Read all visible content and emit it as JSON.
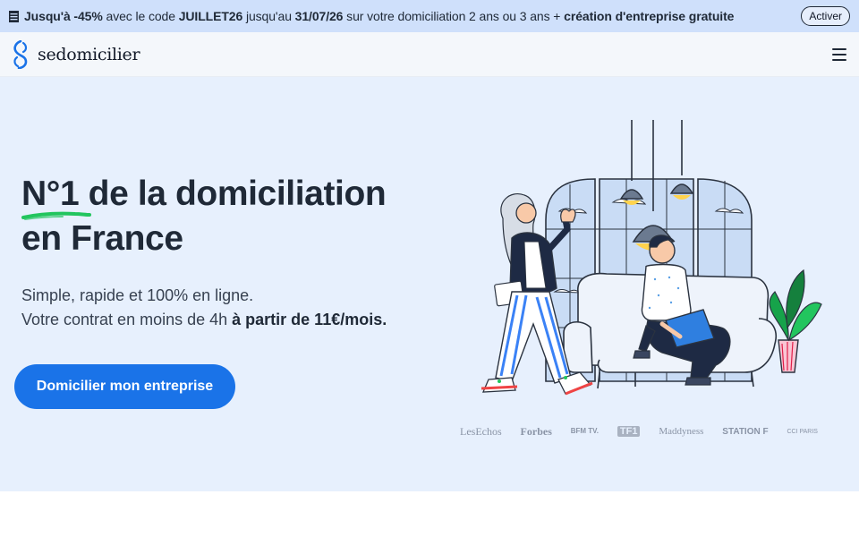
{
  "promo": {
    "part1": "Jusqu'à -45%",
    "part2": " avec le code ",
    "code": "JUILLET26",
    "part3": " jusqu'au ",
    "date": "31/07/26",
    "part4": " sur votre domiciliation 2 ans ou 3 ans + ",
    "part5": "création d'entreprise gratuite",
    "button": "Activer"
  },
  "header": {
    "logo_text": "sedomicilier"
  },
  "hero": {
    "title_line1": "N°1 de la domiciliation",
    "title_line2": "en France",
    "sub_line1": "Simple, rapide et 100% en ligne.",
    "sub_line2_prefix": "Votre contrat en moins de 4h ",
    "sub_line2_bold": "à partir de 11€/mois.",
    "cta": "Domicilier mon entreprise"
  },
  "press": {
    "logos": [
      "LesEchos",
      "Forbes",
      "BFM TV.",
      "TF1",
      "Maddyness",
      "STATION F",
      "CCI PARIS"
    ]
  },
  "colors": {
    "accent": "#1a73e8",
    "hero_bg": "#e7f0fd",
    "promo_bg": "#cfe0fb",
    "underline": "#22c55e"
  }
}
